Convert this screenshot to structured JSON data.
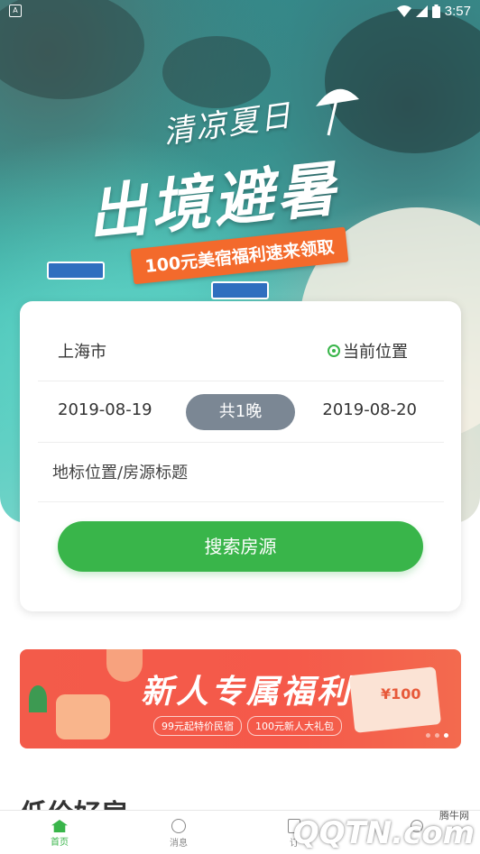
{
  "status_bar": {
    "notification_icon": "A",
    "time": "3:57",
    "icons": [
      "wifi-icon",
      "signal-icon",
      "battery-icon"
    ]
  },
  "hero": {
    "title_small": "清凉夏日",
    "title_big": "出境避暑",
    "ribbon": "100元美宿福利速来领取"
  },
  "search": {
    "city": "上海市",
    "current_location_label": "当前位置",
    "checkin_date": "2019-08-19",
    "nights_label": "共1晚",
    "checkout_date": "2019-08-20",
    "keyword_placeholder": "地标位置/房源标题",
    "keyword_value": "",
    "search_button_label": "搜索房源"
  },
  "promo": {
    "title": "新人专属福利",
    "tags": [
      "99元起特价民宿",
      "100元新人大礼包"
    ],
    "card_value": "¥100"
  },
  "section": {
    "title": "低价好房"
  },
  "bottom_nav": {
    "items": [
      {
        "label": "首页",
        "icon": "home-icon",
        "active": true
      },
      {
        "label": "消息",
        "icon": "message-icon",
        "active": false
      },
      {
        "label": "订",
        "icon": "order-icon",
        "active": false
      },
      {
        "label": "",
        "icon": "profile-icon",
        "active": false
      }
    ]
  },
  "watermark": {
    "text": "QQTN.com",
    "caption": "腾牛网"
  },
  "colors": {
    "accent": "#39b54a",
    "pill": "#7b8794",
    "ribbon": "#f36a2c",
    "promo": "#f35b4a"
  }
}
